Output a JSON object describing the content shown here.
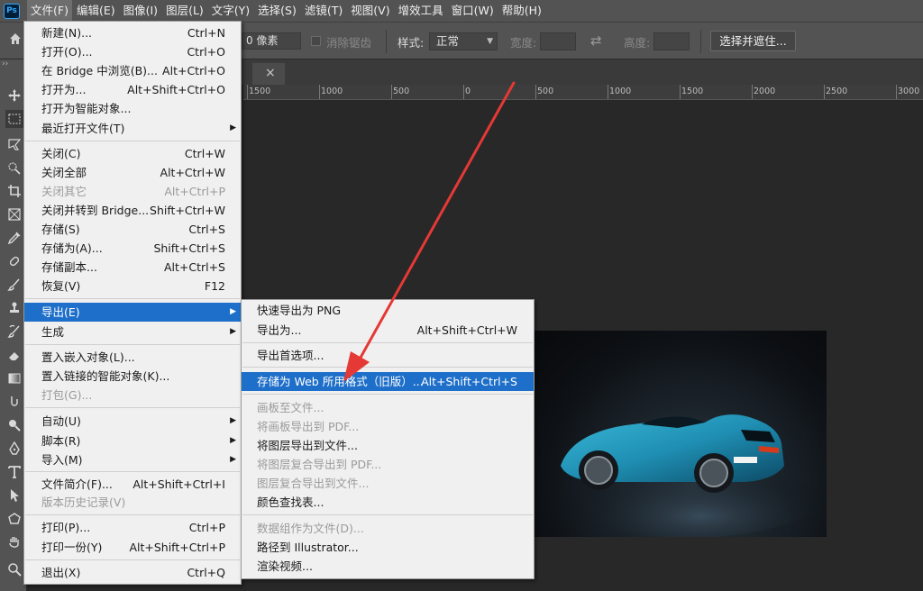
{
  "app": {
    "logo_text": "Ps"
  },
  "menubar": {
    "items": [
      "文件(F)",
      "编辑(E)",
      "图像(I)",
      "图层(L)",
      "文字(Y)",
      "选择(S)",
      "滤镜(T)",
      "视图(V)",
      "增效工具",
      "窗口(W)",
      "帮助(H)"
    ],
    "active_index": 0
  },
  "options": {
    "feather_value": "0 像素",
    "antialias_label": "消除锯齿",
    "style_label": "样式:",
    "style_value": "正常",
    "width_label": "宽度:",
    "height_label": "高度:",
    "select_mask_label": "选择并遮住..."
  },
  "tab": {
    "close_glyph": "×"
  },
  "ruler": {
    "labels": [
      "1500",
      "1000",
      "500",
      "0",
      "500",
      "1000",
      "1500",
      "2000",
      "2500",
      "3000"
    ]
  },
  "file_menu": {
    "items": [
      {
        "label": "新建(N)...",
        "shortcut": "Ctrl+N"
      },
      {
        "label": "打开(O)...",
        "shortcut": "Ctrl+O"
      },
      {
        "label": "在 Bridge 中浏览(B)...",
        "shortcut": "Alt+Ctrl+O"
      },
      {
        "label": "打开为...",
        "shortcut": "Alt+Shift+Ctrl+O"
      },
      {
        "label": "打开为智能对象...",
        "shortcut": ""
      },
      {
        "label": "最近打开文件(T)",
        "shortcut": "",
        "submenu": true
      },
      {
        "label": "关闭(C)",
        "shortcut": "Ctrl+W"
      },
      {
        "label": "关闭全部",
        "shortcut": "Alt+Ctrl+W"
      },
      {
        "label": "关闭其它",
        "shortcut": "Alt+Ctrl+P",
        "disabled": true
      },
      {
        "label": "关闭并转到 Bridge...",
        "shortcut": "Shift+Ctrl+W"
      },
      {
        "label": "存储(S)",
        "shortcut": "Ctrl+S"
      },
      {
        "label": "存储为(A)...",
        "shortcut": "Shift+Ctrl+S"
      },
      {
        "label": "存储副本...",
        "shortcut": "Alt+Ctrl+S"
      },
      {
        "label": "恢复(V)",
        "shortcut": "F12"
      },
      {
        "label": "导出(E)",
        "shortcut": "",
        "submenu": true,
        "highlighted": true
      },
      {
        "label": "生成",
        "shortcut": "",
        "submenu": true
      },
      {
        "label": "置入嵌入对象(L)...",
        "shortcut": ""
      },
      {
        "label": "置入链接的智能对象(K)...",
        "shortcut": ""
      },
      {
        "label": "打包(G)...",
        "shortcut": "",
        "disabled": true
      },
      {
        "label": "自动(U)",
        "shortcut": "",
        "submenu": true
      },
      {
        "label": "脚本(R)",
        "shortcut": "",
        "submenu": true
      },
      {
        "label": "导入(M)",
        "shortcut": "",
        "submenu": true
      },
      {
        "label": "文件简介(F)...",
        "shortcut": "Alt+Shift+Ctrl+I"
      },
      {
        "label": "版本历史记录(V)",
        "shortcut": "",
        "disabled": true
      },
      {
        "label": "打印(P)...",
        "shortcut": "Ctrl+P"
      },
      {
        "label": "打印一份(Y)",
        "shortcut": "Alt+Shift+Ctrl+P"
      },
      {
        "label": "退出(X)",
        "shortcut": "Ctrl+Q"
      }
    ]
  },
  "export_menu": {
    "items": [
      {
        "label": "快速导出为 PNG",
        "shortcut": ""
      },
      {
        "label": "导出为...",
        "shortcut": "Alt+Shift+Ctrl+W"
      },
      {
        "label": "导出首选项...",
        "shortcut": ""
      },
      {
        "label": "存储为 Web 所用格式（旧版）...",
        "shortcut": "Alt+Shift+Ctrl+S",
        "highlighted": true
      },
      {
        "label": "画板至文件...",
        "shortcut": "",
        "disabled": true
      },
      {
        "label": "将画板导出到 PDF...",
        "shortcut": "",
        "disabled": true
      },
      {
        "label": "将图层导出到文件...",
        "shortcut": ""
      },
      {
        "label": "将图层复合导出到 PDF...",
        "shortcut": "",
        "disabled": true
      },
      {
        "label": "图层复合导出到文件...",
        "shortcut": "",
        "disabled": true
      },
      {
        "label": "颜色查找表...",
        "shortcut": ""
      },
      {
        "label": "数据组作为文件(D)...",
        "shortcut": "",
        "disabled": true
      },
      {
        "label": "路径到 Illustrator...",
        "shortcut": ""
      },
      {
        "label": "渲染视频...",
        "shortcut": ""
      }
    ]
  },
  "colors": {
    "menu_highlight": "#1e6fc9",
    "annotation_arrow": "#e53935",
    "car_body": "#1f8fb3"
  }
}
